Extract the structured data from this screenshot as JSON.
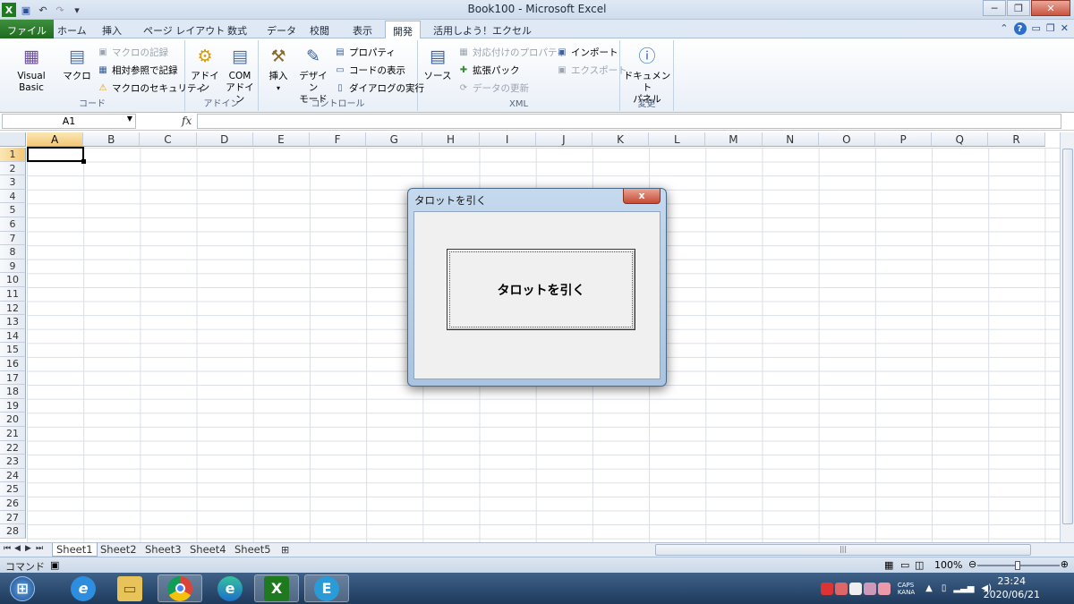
{
  "window": {
    "title": "Book100  -  Microsoft Excel"
  },
  "tabs": [
    "ファイル",
    "ホーム",
    "挿入",
    "ページ レイアウト",
    "数式",
    "データ",
    "校閲",
    "表示",
    "開発",
    "活用しよう！エクセル"
  ],
  "ribbon": {
    "code": {
      "label": "コード",
      "visual_basic": "Visual Basic",
      "macro": "マクロ",
      "record": "マクロの記録",
      "relative": "相対参照で記録",
      "security": "マクロのセキュリティ"
    },
    "addin": {
      "label": "アドイン",
      "addin": "アドイン",
      "com_1": "COM",
      "com_2": "アドイン"
    },
    "control": {
      "label": "コントロール",
      "insert": "挿入",
      "design_1": "デザイン",
      "design_2": "モード",
      "properties": "プロパティ",
      "view_code": "コードの表示",
      "dialog": "ダイアログの実行"
    },
    "xml": {
      "label": "XML",
      "source": "ソース",
      "map_props": "対応付けのプロパティ",
      "expansion": "拡張パック",
      "refresh": "データの更新",
      "import": "インポート",
      "export": "エクスポート"
    },
    "modify": {
      "label": "変更",
      "doc_1": "ドキュメント",
      "doc_2": "パネル"
    }
  },
  "formula_bar": {
    "name_box": "A1",
    "fx": "fx",
    "value": ""
  },
  "columns": [
    "A",
    "B",
    "C",
    "D",
    "E",
    "F",
    "G",
    "H",
    "I",
    "J",
    "K",
    "L",
    "M",
    "N",
    "O",
    "P",
    "Q",
    "R"
  ],
  "rows": [
    "1",
    "2",
    "3",
    "4",
    "5",
    "6",
    "7",
    "8",
    "9",
    "10",
    "11",
    "12",
    "13",
    "14",
    "15",
    "16",
    "17",
    "18",
    "19",
    "20",
    "21",
    "22",
    "23",
    "24",
    "25",
    "26",
    "27",
    "28"
  ],
  "sheets": [
    "Sheet1",
    "Sheet2",
    "Sheet3",
    "Sheet4",
    "Sheet5"
  ],
  "status": {
    "mode": "コマンド",
    "zoom": "100%"
  },
  "dialog": {
    "title": "タロットを引く",
    "button_label": "タロットを引く",
    "close": "x"
  },
  "taskbar": {
    "ime_caps": "CAPS",
    "ime_kana": "KANA",
    "time": "23:24",
    "date": "2020/06/21"
  }
}
